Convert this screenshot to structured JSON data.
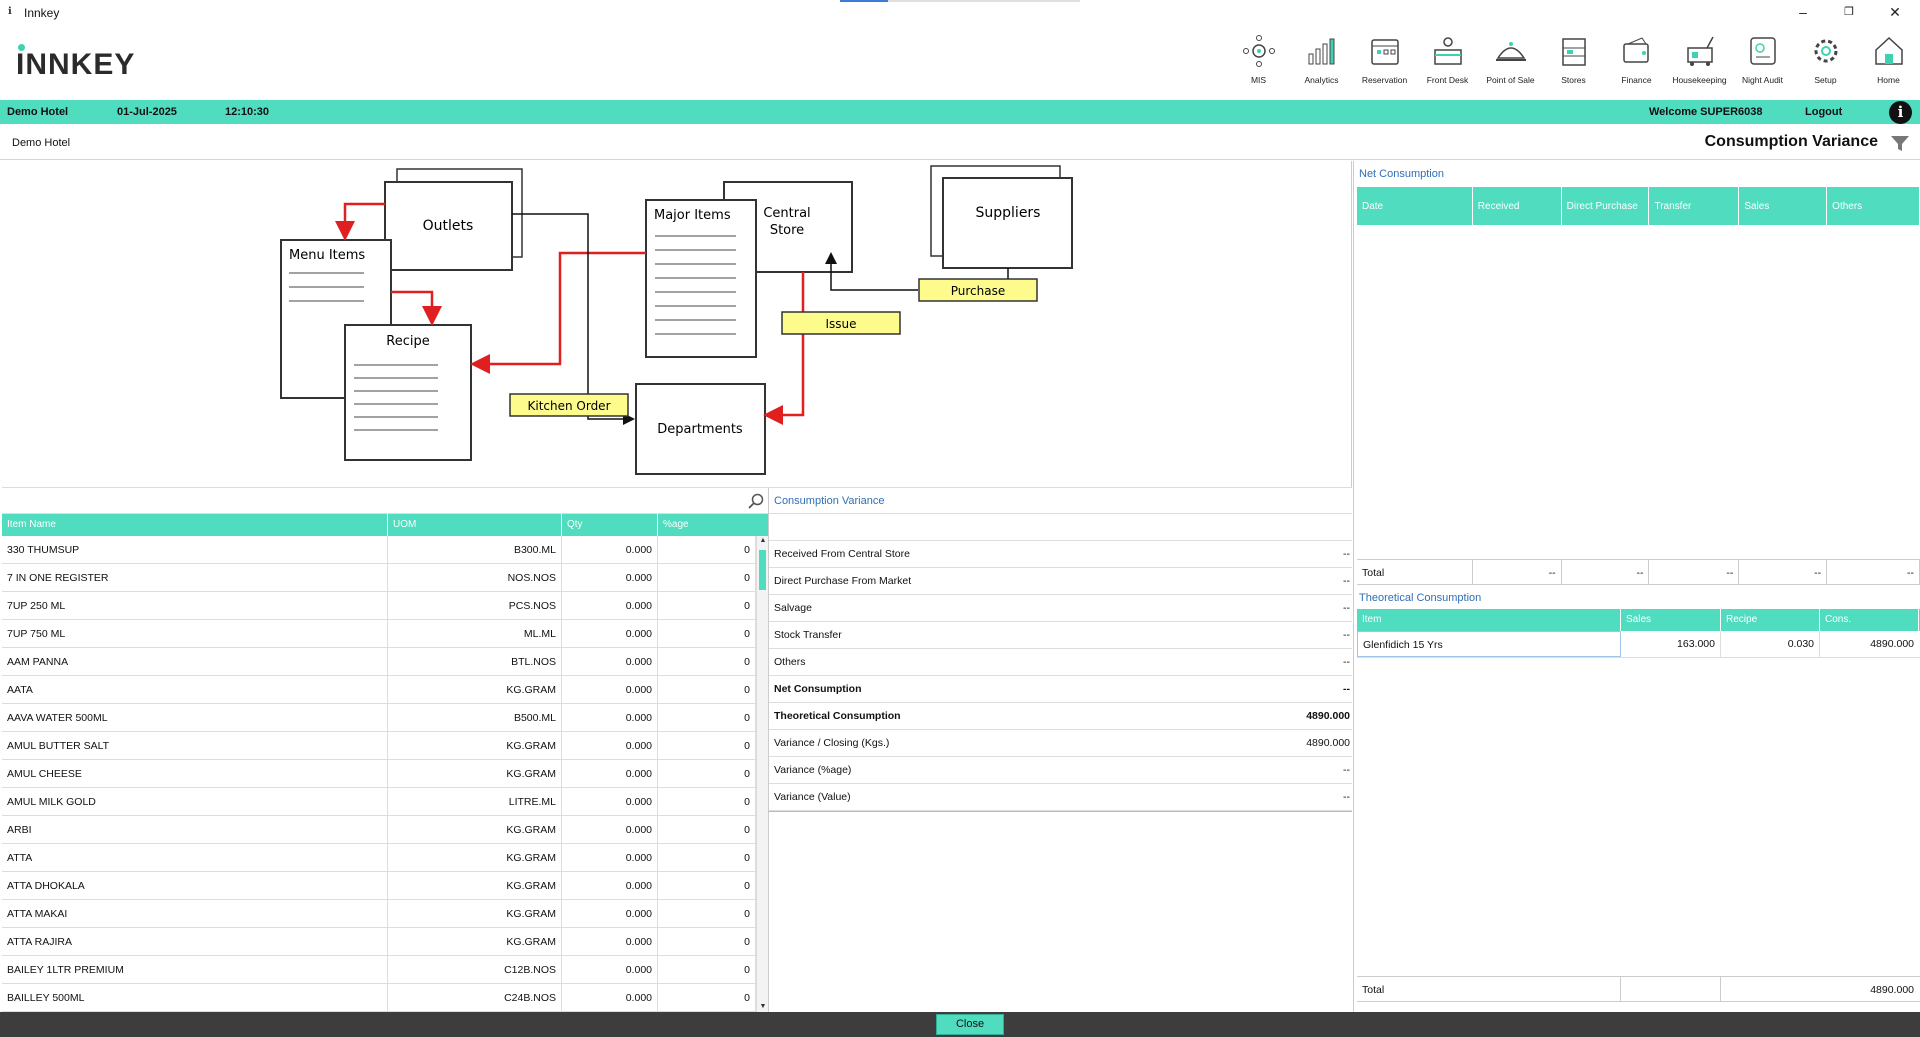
{
  "window": {
    "title": "Innkey",
    "minimize": "–",
    "maximize": "❐",
    "close": "✕"
  },
  "logo": "INNKEY",
  "modules": [
    {
      "label": "MIS",
      "icon": "mis-icon"
    },
    {
      "label": "Analytics",
      "icon": "analytics-icon"
    },
    {
      "label": "Reservation",
      "icon": "reservation-icon"
    },
    {
      "label": "Front Desk",
      "icon": "front-desk-icon"
    },
    {
      "label": "Point of Sale",
      "icon": "point-of-sale-icon"
    },
    {
      "label": "Stores",
      "icon": "stores-icon"
    },
    {
      "label": "Finance",
      "icon": "finance-icon"
    },
    {
      "label": "Housekeeping",
      "icon": "housekeeping-icon"
    },
    {
      "label": "Night Audit",
      "icon": "night-audit-icon"
    },
    {
      "label": "Setup",
      "icon": "setup-icon"
    },
    {
      "label": "Home",
      "icon": "home-icon"
    }
  ],
  "infobar": {
    "hotel": "Demo Hotel",
    "date": "01-Jul-2025",
    "time": "12:10:30",
    "welcome": "Welcome SUPER6038",
    "logout": "Logout",
    "info": "i"
  },
  "subhead": {
    "hotel": "Demo Hotel",
    "title": "Consumption Variance"
  },
  "diagram": {
    "outlets": "Outlets",
    "menu_items": "Menu Items",
    "recipe": "Recipe",
    "major_items": "Major Items",
    "central_store_1": "Central",
    "central_store_2": "Store",
    "suppliers": "Suppliers",
    "purchase": "Purchase",
    "issue": "Issue",
    "kitchen_order": "Kitchen Order",
    "departments": "Departments"
  },
  "items_table": {
    "headers": {
      "name": "Item Name",
      "uom": "UOM",
      "qty": "Qty",
      "pct": "%age"
    },
    "rows": [
      {
        "name": "330 THUMSUP",
        "uom": "B300.ML",
        "qty": "0.000",
        "pct": "0"
      },
      {
        "name": "7 IN ONE REGISTER",
        "uom": "NOS.NOS",
        "qty": "0.000",
        "pct": "0"
      },
      {
        "name": "7UP 250 ML",
        "uom": "PCS.NOS",
        "qty": "0.000",
        "pct": "0"
      },
      {
        "name": "7UP 750 ML",
        "uom": "ML.ML",
        "qty": "0.000",
        "pct": "0"
      },
      {
        "name": "AAM PANNA",
        "uom": "BTL.NOS",
        "qty": "0.000",
        "pct": "0"
      },
      {
        "name": "AATA",
        "uom": "KG.GRAM",
        "qty": "0.000",
        "pct": "0"
      },
      {
        "name": "AAVA WATER 500ML",
        "uom": "B500.ML",
        "qty": "0.000",
        "pct": "0"
      },
      {
        "name": "AMUL BUTTER SALT",
        "uom": "KG.GRAM",
        "qty": "0.000",
        "pct": "0"
      },
      {
        "name": "AMUL CHEESE",
        "uom": "KG.GRAM",
        "qty": "0.000",
        "pct": "0"
      },
      {
        "name": "AMUL MILK GOLD",
        "uom": "LITRE.ML",
        "qty": "0.000",
        "pct": "0"
      },
      {
        "name": "ARBI",
        "uom": "KG.GRAM",
        "qty": "0.000",
        "pct": "0"
      },
      {
        "name": "ATTA",
        "uom": "KG.GRAM",
        "qty": "0.000",
        "pct": "0"
      },
      {
        "name": "ATTA DHOKALA",
        "uom": "KG.GRAM",
        "qty": "0.000",
        "pct": "0"
      },
      {
        "name": "ATTA MAKAI",
        "uom": "KG.GRAM",
        "qty": "0.000",
        "pct": "0"
      },
      {
        "name": "ATTA RAJIRA",
        "uom": "KG.GRAM",
        "qty": "0.000",
        "pct": "0"
      },
      {
        "name": "BAILEY 1LTR PREMIUM",
        "uom": "C12B.NOS",
        "qty": "0.000",
        "pct": "0"
      },
      {
        "name": "BAILLEY 500ML",
        "uom": "C24B.NOS",
        "qty": "0.000",
        "pct": "0"
      }
    ]
  },
  "consumption_variance": {
    "title": "Consumption Variance",
    "rows": [
      {
        "label": "Received From Central Store",
        "value": "--",
        "bold": false
      },
      {
        "label": "Direct Purchase From Market",
        "value": "--",
        "bold": false
      },
      {
        "label": "Salvage",
        "value": "--",
        "bold": false
      },
      {
        "label": "Stock Transfer",
        "value": "--",
        "bold": false
      },
      {
        "label": "Others",
        "value": "--",
        "bold": false
      },
      {
        "label": "Net Consumption",
        "value": "--",
        "bold": true
      },
      {
        "label": "Theoretical Consumption",
        "value": "4890.000",
        "bold": true
      },
      {
        "label": "Variance / Closing (Kgs.)",
        "value": "4890.000",
        "bold": false
      },
      {
        "label": "Variance (%age)",
        "value": "--",
        "bold": false
      },
      {
        "label": "Variance (Value)",
        "value": "--",
        "bold": false
      }
    ]
  },
  "net_consumption": {
    "title": "Net Consumption",
    "headers": [
      "Date",
      "Received",
      "Direct Purchase",
      "Transfer",
      "Sales",
      "Others"
    ],
    "total_label": "Total",
    "totals": [
      "--",
      "--",
      "--",
      "--",
      "--"
    ]
  },
  "theoretical_consumption": {
    "title": "Theoretical Consumption",
    "headers": [
      "Item",
      "Sales",
      "Recipe",
      "Cons."
    ],
    "rows": [
      {
        "item": "Glenfidich 15 Yrs",
        "sales": "163.000",
        "recipe": "0.030",
        "cons": "4890.000"
      }
    ],
    "total_label": "Total",
    "total_cons": "4890.000"
  },
  "footer": {
    "close": "Close"
  }
}
